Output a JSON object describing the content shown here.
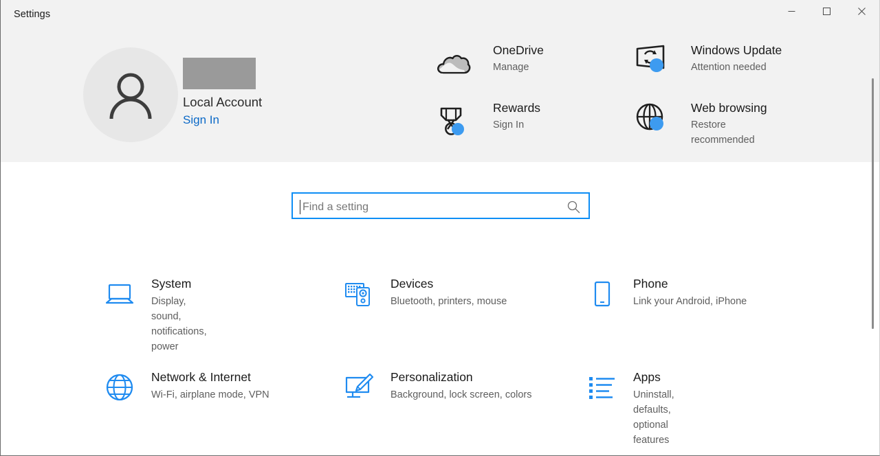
{
  "window": {
    "title": "Settings",
    "caption": {
      "minimize": "minimize-button",
      "maximize": "maximize-button",
      "close": "close-button"
    }
  },
  "account": {
    "name_redacted": "",
    "type": "Local Account",
    "sign_in": "Sign In",
    "avatar_icon": "person-icon"
  },
  "quick_links": [
    {
      "id": "onedrive",
      "icon": "cloud-icon",
      "title": "OneDrive",
      "subtitle": "Manage",
      "badge": false
    },
    {
      "id": "rewards",
      "icon": "medal-icon",
      "title": "Rewards",
      "subtitle": "Sign In",
      "badge": true
    },
    {
      "id": "windows-update",
      "icon": "monitor-refresh-icon",
      "title": "Windows Update",
      "subtitle": "Attention needed",
      "badge": true
    },
    {
      "id": "web-browsing",
      "icon": "globe-icon",
      "title": "Web browsing",
      "subtitle": "Restore recommended",
      "badge": true
    }
  ],
  "search": {
    "placeholder": "Find a setting",
    "value": "",
    "icon": "search-icon"
  },
  "categories": [
    {
      "id": "system",
      "icon": "laptop-icon",
      "title": "System",
      "subtitle": "Display, sound, notifications, power"
    },
    {
      "id": "devices",
      "icon": "keyboard-mouse-icon",
      "title": "Devices",
      "subtitle": "Bluetooth, printers, mouse"
    },
    {
      "id": "phone",
      "icon": "phone-icon",
      "title": "Phone",
      "subtitle": "Link your Android, iPhone"
    },
    {
      "id": "network",
      "icon": "globe-icon",
      "title": "Network & Internet",
      "subtitle": "Wi-Fi, airplane mode, VPN"
    },
    {
      "id": "personalization",
      "icon": "monitor-brush-icon",
      "title": "Personalization",
      "subtitle": "Background, lock screen, colors"
    },
    {
      "id": "apps",
      "icon": "list-icon",
      "title": "Apps",
      "subtitle": "Uninstall, defaults, optional features"
    }
  ],
  "colors": {
    "accent": "#0d8ef5",
    "icon_blue": "#1f8bf0",
    "header_bg": "#f2f2f2",
    "link": "#0b69c7",
    "badge": "#3d9bf0"
  }
}
